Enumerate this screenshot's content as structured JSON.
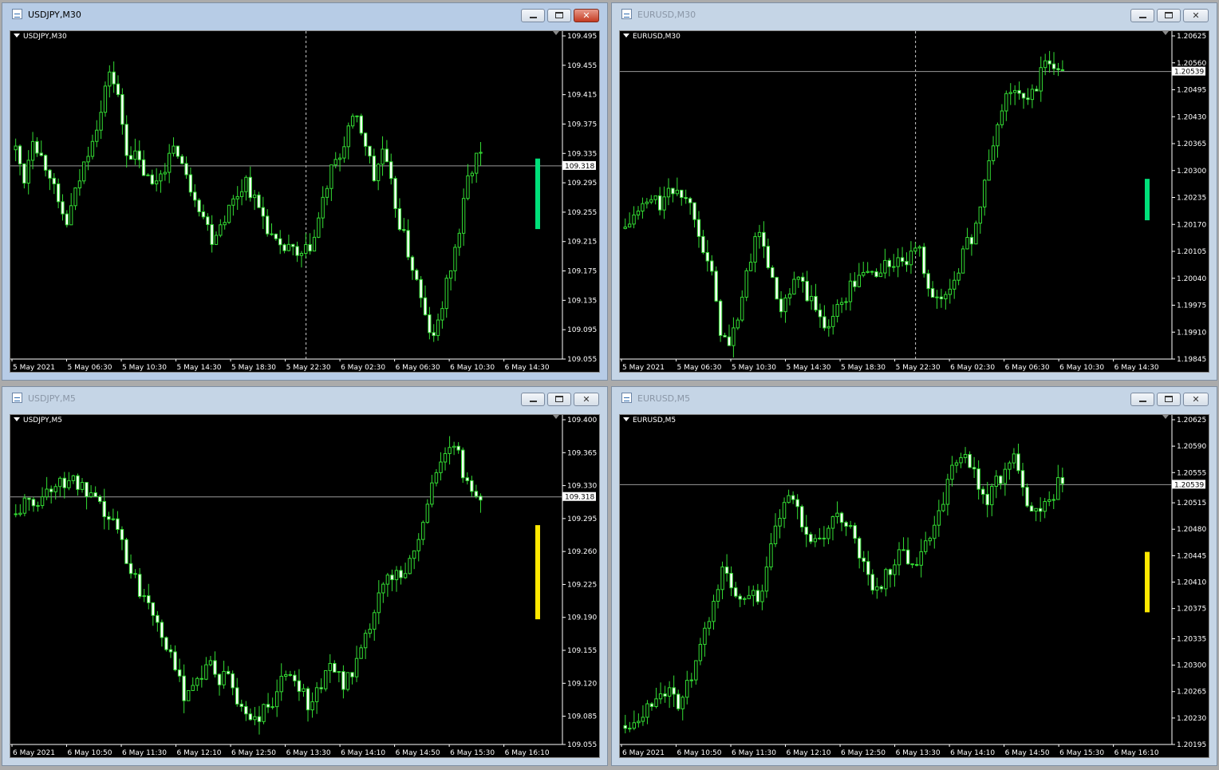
{
  "windows": [
    {
      "title": "USDJPY,M30",
      "label": "USDJPY,M30",
      "active": true,
      "y_ticks": [
        "109.495",
        "109.455",
        "109.415",
        "109.375",
        "109.335",
        "109.295",
        "109.255",
        "109.215",
        "109.175",
        "109.135",
        "109.095",
        "109.055"
      ],
      "y_range": [
        109.055,
        109.495
      ],
      "current_price": "109.318",
      "x_ticks": [
        "5 May 2021",
        "5 May 06:30",
        "5 May 10:30",
        "5 May 14:30",
        "5 May 18:30",
        "5 May 22:30",
        "6 May 02:30",
        "6 May 06:30",
        "6 May 10:30",
        "6 May 14:30"
      ],
      "period_separator_index": 5,
      "indicator_color": "#00E07A",
      "indicator_range": [
        109.232,
        109.328
      ],
      "close_path": [
        109.34,
        109.3,
        109.36,
        109.33,
        109.31,
        109.26,
        109.24,
        109.28,
        109.32,
        109.36,
        109.39,
        109.45,
        109.41,
        109.34,
        109.33,
        109.31,
        109.29,
        109.31,
        109.33,
        109.34,
        109.3,
        109.28,
        109.25,
        109.22,
        109.24,
        109.26,
        109.28,
        109.3,
        109.27,
        109.25,
        109.22,
        109.2,
        109.21,
        109.19,
        109.2,
        109.22,
        109.27,
        109.31,
        109.33,
        109.37,
        109.38,
        109.35,
        109.3,
        109.34,
        109.29,
        109.24,
        109.2,
        109.16,
        109.11,
        109.08,
        109.13,
        109.18,
        109.23,
        109.3,
        109.33
      ]
    },
    {
      "title": "EURUSD,M30",
      "label": "EURUSD,M30",
      "active": false,
      "y_ticks": [
        "1.20625",
        "1.20560",
        "1.20495",
        "1.20430",
        "1.20365",
        "1.20300",
        "1.20235",
        "1.20170",
        "1.20105",
        "1.20040",
        "1.19975",
        "1.19910",
        "1.19845"
      ],
      "y_range": [
        1.19845,
        1.20625
      ],
      "current_price": "1.20539",
      "x_ticks": [
        "5 May 2021",
        "5 May 06:30",
        "5 May 10:30",
        "5 May 14:30",
        "5 May 18:30",
        "5 May 22:30",
        "6 May 02:30",
        "6 May 06:30",
        "6 May 10:30",
        "6 May 14:30"
      ],
      "period_separator_index": 5,
      "indicator_color": "#00E07A",
      "indicator_range": [
        1.2018,
        1.2028
      ],
      "close_path": [
        1.2016,
        1.2019,
        1.2021,
        1.2023,
        1.2022,
        1.2024,
        1.2026,
        1.2023,
        1.202,
        1.2012,
        1.2004,
        1.1992,
        1.1987,
        1.1995,
        1.2004,
        1.2015,
        1.2012,
        1.2003,
        1.1995,
        1.2,
        1.2004,
        1.2,
        1.1996,
        1.1993,
        1.1995,
        1.1998,
        1.2002,
        1.2004,
        1.2006,
        1.2005,
        1.2007,
        1.2008,
        1.2007,
        1.2009,
        1.201,
        1.2003,
        1.1998,
        1.2,
        1.2004,
        1.201,
        1.2014,
        1.2021,
        1.2032,
        1.2041,
        1.2048,
        1.205,
        1.2046,
        1.2049,
        1.2053,
        1.2057,
        1.2054
      ]
    },
    {
      "title": "USDJPY,M5",
      "label": "USDJPY,M5",
      "active": false,
      "y_ticks": [
        "109.400",
        "109.365",
        "109.330",
        "109.295",
        "109.260",
        "109.225",
        "109.190",
        "109.155",
        "109.120",
        "109.085",
        "109.055"
      ],
      "y_range": [
        109.055,
        109.4
      ],
      "current_price": "109.318",
      "x_ticks": [
        "6 May 2021",
        "6 May 10:50",
        "6 May 11:30",
        "6 May 12:10",
        "6 May 12:50",
        "6 May 13:30",
        "6 May 14:10",
        "6 May 14:50",
        "6 May 15:30",
        "6 May 16:10"
      ],
      "period_separator_index": null,
      "indicator_color": "#FFE800",
      "indicator_range": [
        109.188,
        109.288
      ],
      "close_path": [
        109.3,
        109.31,
        109.31,
        109.32,
        109.33,
        109.33,
        109.34,
        109.33,
        109.32,
        109.31,
        109.3,
        109.29,
        109.27,
        109.24,
        109.22,
        109.21,
        109.19,
        109.16,
        109.13,
        109.11,
        109.12,
        109.13,
        109.14,
        109.12,
        109.13,
        109.1,
        109.09,
        109.08,
        109.09,
        109.1,
        109.12,
        109.13,
        109.12,
        109.1,
        109.11,
        109.13,
        109.14,
        109.12,
        109.13,
        109.15,
        109.18,
        109.21,
        109.23,
        109.24,
        109.24,
        109.26,
        109.29,
        109.33,
        109.36,
        109.37,
        109.36,
        109.33,
        109.32
      ]
    },
    {
      "title": "EURUSD,M5",
      "label": "EURUSD,M5",
      "active": false,
      "y_ticks": [
        "1.20625",
        "1.20590",
        "1.20555",
        "1.20515",
        "1.20480",
        "1.20445",
        "1.20410",
        "1.20375",
        "1.20335",
        "1.20300",
        "1.20265",
        "1.20230",
        "1.20195"
      ],
      "y_range": [
        1.20195,
        1.20625
      ],
      "current_price": "1.20539",
      "x_ticks": [
        "6 May 2021",
        "6 May 10:50",
        "6 May 11:30",
        "6 May 12:10",
        "6 May 12:50",
        "6 May 13:30",
        "6 May 14:10",
        "6 May 14:50",
        "6 May 15:30",
        "6 May 16:10"
      ],
      "period_separator_index": null,
      "indicator_color": "#FFE800",
      "indicator_range": [
        1.2037,
        1.2045
      ],
      "close_path": [
        1.2022,
        1.2023,
        1.2024,
        1.2025,
        1.2027,
        1.2026,
        1.2025,
        1.2027,
        1.203,
        1.2034,
        1.2038,
        1.2043,
        1.204,
        1.2039,
        1.204,
        1.2039,
        1.2042,
        1.2048,
        1.2051,
        1.2052,
        1.2049,
        1.2047,
        1.2046,
        1.2048,
        1.205,
        1.2049,
        1.2046,
        1.2043,
        1.204,
        1.2041,
        1.2043,
        1.2045,
        1.2044,
        1.2044,
        1.2046,
        1.2049,
        1.2052,
        1.2056,
        1.2058,
        1.2057,
        1.2053,
        1.2052,
        1.2054,
        1.2056,
        1.2057,
        1.2053,
        1.2051,
        1.205,
        1.2052,
        1.2054
      ]
    }
  ]
}
